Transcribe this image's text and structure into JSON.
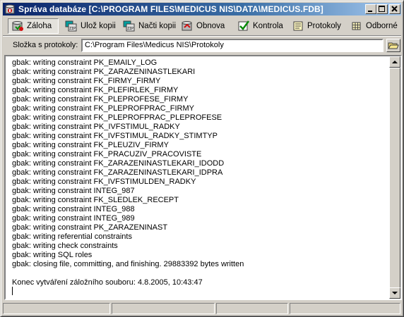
{
  "window": {
    "title": "Správa databáze [C:\\PROGRAM FILES\\MEDICUS NIS\\DATA\\MEDICUS.FDB]"
  },
  "toolbar": {
    "items": [
      {
        "label": "Záloha",
        "icon": "database-backup-icon",
        "pressed": true
      },
      {
        "label": "Ulož kopii",
        "icon": "save-copy-icon"
      },
      {
        "label": "Načti kopii",
        "icon": "load-copy-icon"
      },
      {
        "label": "Obnova",
        "icon": "restore-icon"
      },
      {
        "label": "Kontrola",
        "icon": "checkmark-icon"
      },
      {
        "label": "Protokoly",
        "icon": "log-document-icon"
      },
      {
        "label": "Odborné",
        "icon": "grid-icon"
      }
    ]
  },
  "folder": {
    "label": "Složka s protokoly:",
    "value": "C:\\Program Files\\Medicus NIS\\Protokoly"
  },
  "log": {
    "lines": [
      "gbak: writing constraint PK_EMAILY_LOG",
      "gbak: writing constraint PK_ZARAZENINASTLEKARI",
      "gbak: writing constraint FK_FIRMY_FIRMY",
      "gbak: writing constraint FK_PLEFIRLEK_FIRMY",
      "gbak: writing constraint FK_PLEPROFESE_FIRMY",
      "gbak: writing constraint FK_PLEPROFPRAC_FIRMY",
      "gbak: writing constraint FK_PLEPROFPRAC_PLEPROFESE",
      "gbak: writing constraint PK_IVFSTIMUL_RADKY",
      "gbak: writing constraint FK_IVFSTIMUL_RADKY_STIMTYP",
      "gbak: writing constraint FK_PLEUZIV_FIRMY",
      "gbak: writing constraint FK_PRACUZIV_PRACOVISTE",
      "gbak: writing constraint FK_ZARAZENINASTLEKARI_IDODD",
      "gbak: writing constraint FK_ZARAZENINASTLEKARI_IDPRA",
      "gbak: writing constraint FK_IVFSTIMULDEN_RADKY",
      "gbak: writing constraint INTEG_987",
      "gbak: writing constraint FK_SLEDLEK_RECEPT",
      "gbak: writing constraint INTEG_988",
      "gbak: writing constraint INTEG_989",
      "gbak: writing constraint PK_ZARAZENINAST",
      "gbak: writing referential constraints",
      "gbak: writing check constraints",
      "gbak: writing SQL roles",
      "gbak: closing file, committing, and finishing. 29883392 bytes written",
      "",
      "Konec vytváření záložního souboru: 4.8.2005, 10:43:47"
    ]
  }
}
